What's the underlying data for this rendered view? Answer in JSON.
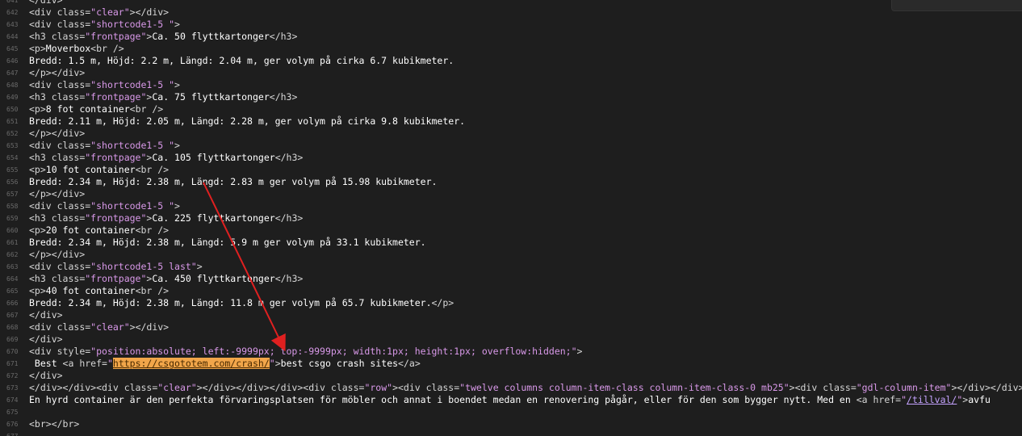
{
  "lines": [
    {
      "num": "641",
      "segs": [
        {
          "c": "tag",
          "t": "</div>"
        }
      ]
    },
    {
      "num": "642",
      "segs": [
        {
          "c": "tag",
          "t": "<div "
        },
        {
          "c": "attr",
          "t": "class="
        },
        {
          "c": "str",
          "t": "\"clear\""
        },
        {
          "c": "tag",
          "t": "></div>"
        }
      ]
    },
    {
      "num": "643",
      "segs": [
        {
          "c": "tag",
          "t": "<div "
        },
        {
          "c": "attr",
          "t": "class="
        },
        {
          "c": "str",
          "t": "\"shortcode1-5 \""
        },
        {
          "c": "tag",
          "t": ">"
        }
      ]
    },
    {
      "num": "644",
      "segs": [
        {
          "c": "tag",
          "t": "<h3 "
        },
        {
          "c": "attr",
          "t": "class="
        },
        {
          "c": "str",
          "t": "\"frontpage\""
        },
        {
          "c": "tag",
          "t": ">"
        },
        {
          "c": "txt",
          "t": "Ca. 50 flyttkartonger"
        },
        {
          "c": "tag",
          "t": "</h3>"
        }
      ]
    },
    {
      "num": "645",
      "segs": [
        {
          "c": "tag",
          "t": "<p>"
        },
        {
          "c": "txt",
          "t": "Moverbox"
        },
        {
          "c": "tag",
          "t": "<br />"
        }
      ]
    },
    {
      "num": "646",
      "segs": [
        {
          "c": "txt",
          "t": "Bredd: 1.5 m, Höjd: 2.2 m, Längd: 2.04 m, ger volym på cirka 6.7 kubikmeter."
        }
      ]
    },
    {
      "num": "647",
      "segs": [
        {
          "c": "tag",
          "t": "</p></div>"
        }
      ]
    },
    {
      "num": "648",
      "segs": [
        {
          "c": "tag",
          "t": "<div "
        },
        {
          "c": "attr",
          "t": "class="
        },
        {
          "c": "str",
          "t": "\"shortcode1-5 \""
        },
        {
          "c": "tag",
          "t": ">"
        }
      ]
    },
    {
      "num": "649",
      "segs": [
        {
          "c": "tag",
          "t": "<h3 "
        },
        {
          "c": "attr",
          "t": "class="
        },
        {
          "c": "str",
          "t": "\"frontpage\""
        },
        {
          "c": "tag",
          "t": ">"
        },
        {
          "c": "txt",
          "t": "Ca. 75 flyttkartonger"
        },
        {
          "c": "tag",
          "t": "</h3>"
        }
      ]
    },
    {
      "num": "650",
      "segs": [
        {
          "c": "tag",
          "t": "<p>"
        },
        {
          "c": "txt",
          "t": "8 fot container"
        },
        {
          "c": "tag",
          "t": "<br />"
        }
      ]
    },
    {
      "num": "651",
      "segs": [
        {
          "c": "txt",
          "t": "Bredd: 2.11 m, Höjd: 2.05 m, Längd: 2.28 m, ger volym på cirka 9.8 kubikmeter."
        }
      ]
    },
    {
      "num": "652",
      "segs": [
        {
          "c": "tag",
          "t": "</p></div>"
        }
      ]
    },
    {
      "num": "653",
      "segs": [
        {
          "c": "tag",
          "t": "<div "
        },
        {
          "c": "attr",
          "t": "class="
        },
        {
          "c": "str",
          "t": "\"shortcode1-5 \""
        },
        {
          "c": "tag",
          "t": ">"
        }
      ]
    },
    {
      "num": "654",
      "segs": [
        {
          "c": "tag",
          "t": "<h3 "
        },
        {
          "c": "attr",
          "t": "class="
        },
        {
          "c": "str",
          "t": "\"frontpage\""
        },
        {
          "c": "tag",
          "t": ">"
        },
        {
          "c": "txt",
          "t": "Ca. 105 flyttkartonger"
        },
        {
          "c": "tag",
          "t": "</h3>"
        }
      ]
    },
    {
      "num": "655",
      "segs": [
        {
          "c": "tag",
          "t": "<p>"
        },
        {
          "c": "txt",
          "t": "10 fot container"
        },
        {
          "c": "tag",
          "t": "<br />"
        }
      ]
    },
    {
      "num": "656",
      "segs": [
        {
          "c": "txt",
          "t": "Bredd: 2.34 m, Höjd: 2.38 m, Längd: 2.83 m ger volym på 15.98 kubikmeter."
        }
      ]
    },
    {
      "num": "657",
      "segs": [
        {
          "c": "tag",
          "t": "</p></div>"
        }
      ]
    },
    {
      "num": "658",
      "segs": [
        {
          "c": "tag",
          "t": "<div "
        },
        {
          "c": "attr",
          "t": "class="
        },
        {
          "c": "str",
          "t": "\"shortcode1-5 \""
        },
        {
          "c": "tag",
          "t": ">"
        }
      ]
    },
    {
      "num": "659",
      "segs": [
        {
          "c": "tag",
          "t": "<h3 "
        },
        {
          "c": "attr",
          "t": "class="
        },
        {
          "c": "str",
          "t": "\"frontpage\""
        },
        {
          "c": "tag",
          "t": ">"
        },
        {
          "c": "txt",
          "t": "Ca. 225 flyttkartonger"
        },
        {
          "c": "tag",
          "t": "</h3>"
        }
      ]
    },
    {
      "num": "660",
      "segs": [
        {
          "c": "tag",
          "t": "<p>"
        },
        {
          "c": "txt",
          "t": "20 fot container"
        },
        {
          "c": "tag",
          "t": "<br />"
        }
      ]
    },
    {
      "num": "661",
      "segs": [
        {
          "c": "txt",
          "t": "Bredd: 2.34 m, Höjd: 2.38 m, Längd: 5.9 m ger volym på 33.1 kubikmeter."
        }
      ]
    },
    {
      "num": "662",
      "segs": [
        {
          "c": "tag",
          "t": "</p></div>"
        }
      ]
    },
    {
      "num": "663",
      "segs": [
        {
          "c": "tag",
          "t": "<div "
        },
        {
          "c": "attr",
          "t": "class="
        },
        {
          "c": "str",
          "t": "\"shortcode1-5 last\""
        },
        {
          "c": "tag",
          "t": ">"
        }
      ]
    },
    {
      "num": "664",
      "segs": [
        {
          "c": "tag",
          "t": "<h3 "
        },
        {
          "c": "attr",
          "t": "class="
        },
        {
          "c": "str",
          "t": "\"frontpage\""
        },
        {
          "c": "tag",
          "t": ">"
        },
        {
          "c": "txt",
          "t": "Ca. 450 flyttkartonger"
        },
        {
          "c": "tag",
          "t": "</h3>"
        }
      ]
    },
    {
      "num": "665",
      "segs": [
        {
          "c": "tag",
          "t": "<p>"
        },
        {
          "c": "txt",
          "t": "40 fot container"
        },
        {
          "c": "tag",
          "t": "<br />"
        }
      ]
    },
    {
      "num": "666",
      "segs": [
        {
          "c": "txt",
          "t": "Bredd: 2.34 m, Höjd: 2.38 m, Längd: 11.8 m ger volym på 65.7 kubikmeter."
        },
        {
          "c": "tag",
          "t": "</p>"
        }
      ]
    },
    {
      "num": "667",
      "segs": [
        {
          "c": "tag",
          "t": "</div>"
        }
      ]
    },
    {
      "num": "668",
      "segs": [
        {
          "c": "tag",
          "t": "<div "
        },
        {
          "c": "attr",
          "t": "class="
        },
        {
          "c": "str",
          "t": "\"clear\""
        },
        {
          "c": "tag",
          "t": "></div>"
        }
      ]
    },
    {
      "num": "669",
      "segs": [
        {
          "c": "tag",
          "t": "</div>"
        }
      ]
    },
    {
      "num": "670",
      "segs": [
        {
          "c": "tag",
          "t": "<div "
        },
        {
          "c": "attr",
          "t": "style="
        },
        {
          "c": "str",
          "t": "\"position:absolute; left:-9999px; top:-9999px; width:1px; height:1px; overflow:hidden;\""
        },
        {
          "c": "tag",
          "t": ">"
        }
      ]
    },
    {
      "num": "671",
      "segs": [
        {
          "c": "txt",
          "t": " Best "
        },
        {
          "c": "tag",
          "t": "<a "
        },
        {
          "c": "attr",
          "t": "href="
        },
        {
          "c": "str",
          "t": "\""
        },
        {
          "c": "hl",
          "t": "https://csgototem.com/crash/"
        },
        {
          "c": "str",
          "t": "\""
        },
        {
          "c": "tag",
          "t": ">"
        },
        {
          "c": "txt",
          "t": "best csgo crash sites"
        },
        {
          "c": "tag",
          "t": "</a>"
        }
      ]
    },
    {
      "num": "672",
      "segs": [
        {
          "c": "tag",
          "t": "</div>"
        }
      ]
    },
    {
      "num": "673",
      "segs": [
        {
          "c": "tag",
          "t": "</div></div><div "
        },
        {
          "c": "attr",
          "t": "class="
        },
        {
          "c": "str",
          "t": "\"clear\""
        },
        {
          "c": "tag",
          "t": "></div></div></div><div "
        },
        {
          "c": "attr",
          "t": "class="
        },
        {
          "c": "str",
          "t": "\"row\""
        },
        {
          "c": "tag",
          "t": "><div "
        },
        {
          "c": "attr",
          "t": "class="
        },
        {
          "c": "str",
          "t": "\"twelve columns column-item-class column-item-class-0 mb25\""
        },
        {
          "c": "tag",
          "t": "><div "
        },
        {
          "c": "attr",
          "t": "class="
        },
        {
          "c": "str",
          "t": "\"gdl-column-item\""
        },
        {
          "c": "tag",
          "t": "></div></div>"
        }
      ]
    },
    {
      "num": "674",
      "segs": [
        {
          "c": "txt",
          "t": "En hyrd container är den perfekta förvaringsplatsen för möbler och annat i boendet medan en renovering pågår, eller för den som bygger nytt. Med en "
        },
        {
          "c": "tag",
          "t": "<a "
        },
        {
          "c": "attr",
          "t": "href="
        },
        {
          "c": "str",
          "t": "\""
        },
        {
          "c": "link",
          "t": "/tillval/"
        },
        {
          "c": "str",
          "t": "\""
        },
        {
          "c": "tag",
          "t": ">"
        },
        {
          "c": "txt",
          "t": "avfu"
        }
      ]
    },
    {
      "num": "675",
      "segs": []
    },
    {
      "num": "676",
      "segs": [
        {
          "c": "tag",
          "t": "<br></br>"
        }
      ]
    },
    {
      "num": "677",
      "segs": []
    }
  ]
}
